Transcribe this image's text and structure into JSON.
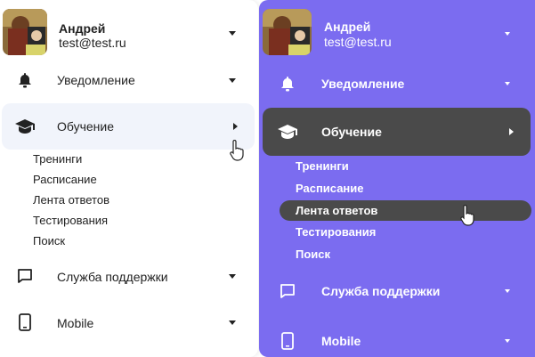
{
  "light": {
    "user": {
      "name": "Андрей",
      "email": "test@test.ru"
    },
    "menu": [
      {
        "label": "Уведомление",
        "icon": "bell-icon"
      },
      {
        "label": "Обучение",
        "icon": "graduation-cap-icon"
      },
      {
        "label": "Служба поддержки",
        "icon": "chat-bubble-icon"
      },
      {
        "label": "Mobile",
        "icon": "smartphone-icon"
      }
    ],
    "submenu": [
      "Тренинги",
      "Расписание",
      "Лента ответов",
      "Тестирования",
      "Поиск"
    ]
  },
  "purple": {
    "user": {
      "name": "Андрей",
      "email": "test@test.ru"
    },
    "menu": [
      {
        "label": "Уведомление",
        "icon": "bell-icon"
      },
      {
        "label": "Обучение",
        "icon": "graduation-cap-icon"
      },
      {
        "label": "Служба поддержки",
        "icon": "chat-bubble-icon"
      },
      {
        "label": "Mobile",
        "icon": "smartphone-icon"
      }
    ],
    "submenu": [
      "Тренинги",
      "Расписание",
      "Лента ответов",
      "Тестирования",
      "Поиск"
    ]
  },
  "colors": {
    "purple_bg": "#7b6cf0",
    "active_dark": "#4a4a4a",
    "light_active": "#f1f4fb",
    "text_dark": "#222222"
  }
}
